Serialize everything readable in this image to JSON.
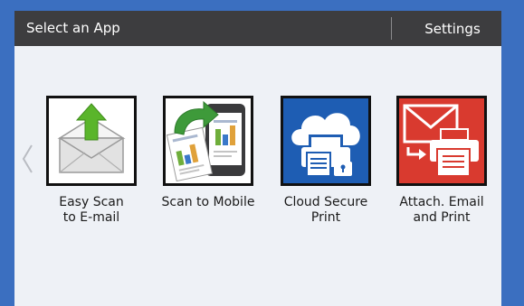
{
  "header": {
    "title": "Select an App",
    "settings_label": "Settings"
  },
  "apps": [
    {
      "label": "Easy Scan\nto E-mail",
      "icon": "envelope-upload-icon"
    },
    {
      "label": "Scan to Mobile",
      "icon": "scan-to-mobile-icon"
    },
    {
      "label": "Cloud Secure\nPrint",
      "icon": "cloud-printer-lock-icon"
    },
    {
      "label": "Attach. Email\nand Print",
      "icon": "email-printer-icon"
    }
  ],
  "colors": {
    "frame": "#3b6fc0",
    "header": "#3d3d3f",
    "screen": "#eef1f6",
    "cloud_tile": "#1e5db3",
    "email_tile": "#d93a2f",
    "upload_arrow": "#5ab52b"
  }
}
